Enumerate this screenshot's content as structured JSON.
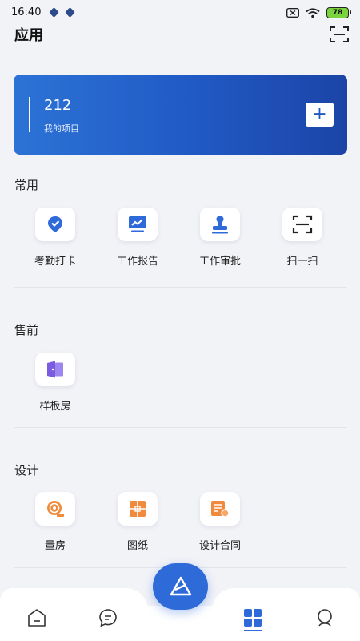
{
  "status_bar": {
    "time": "16:40",
    "battery": "78"
  },
  "header": {
    "title": "应用"
  },
  "project_card": {
    "count": "212",
    "label": "我的项目"
  },
  "sections": [
    {
      "title": "常用",
      "items": [
        {
          "label": "考勤打卡",
          "icon": "location-check-icon"
        },
        {
          "label": "工作报告",
          "icon": "report-chart-icon"
        },
        {
          "label": "工作审批",
          "icon": "approval-stamp-icon"
        },
        {
          "label": "扫一扫",
          "icon": "scan-icon"
        }
      ]
    },
    {
      "title": "售前",
      "items": [
        {
          "label": "样板房",
          "icon": "sample-room-door-icon"
        }
      ]
    },
    {
      "title": "设计",
      "items": [
        {
          "label": "量房",
          "icon": "measuring-tape-icon"
        },
        {
          "label": "图纸",
          "icon": "blueprint-icon"
        },
        {
          "label": "设计合同",
          "icon": "contract-icon"
        }
      ]
    }
  ],
  "tab_bar": {
    "tabs": [
      "home-icon",
      "message-icon",
      "apps-grid-icon",
      "profile-icon"
    ],
    "active": "apps-grid-icon",
    "center_button": "brand-logo-icon"
  },
  "colors": {
    "accent": "#2f6ad9",
    "orange": "#f08a3c",
    "purple": "#7b5ce0",
    "background": "#f2f3f7"
  }
}
